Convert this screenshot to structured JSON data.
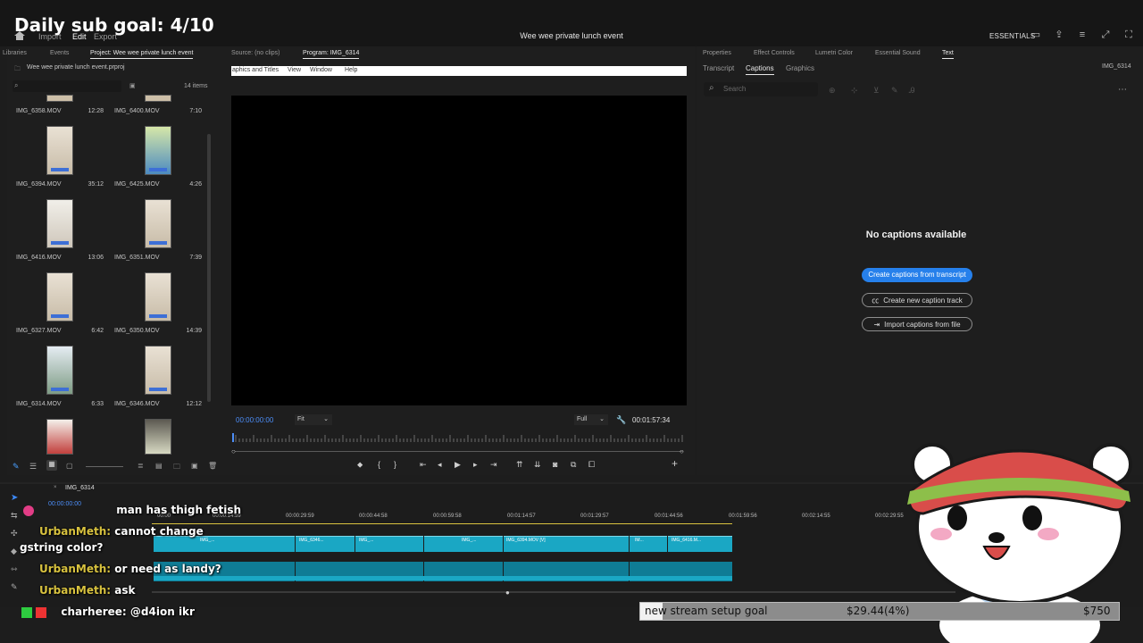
{
  "stream": {
    "goal_title": "Daily sub goal: 4/10",
    "donation_goal": {
      "label": "new stream setup goal",
      "current": "$29.44(4%)",
      "target": "$750",
      "progress_fraction": 0.04
    }
  },
  "app": {
    "menu": [
      "Import",
      "Edit",
      "Export"
    ],
    "active_menu": "Edit",
    "window_title": "Wee wee private lunch event",
    "workspace": "ESSENTIALS"
  },
  "project_panel": {
    "tabs": [
      "Libraries",
      "Events",
      "Project: Wee wee private lunch event"
    ],
    "path": "Wee wee private lunch event.prproj",
    "items_count": "14 items",
    "items": [
      {
        "name": "IMG_6358.MOV",
        "duration": "12:28"
      },
      {
        "name": "IMG_6400.MOV",
        "duration": "7:10"
      },
      {
        "name": "IMG_6394.MOV",
        "duration": "35:12"
      },
      {
        "name": "IMG_6425.MOV",
        "duration": "4:26"
      },
      {
        "name": "IMG_6416.MOV",
        "duration": "13:06"
      },
      {
        "name": "IMG_6351.MOV",
        "duration": "7:39"
      },
      {
        "name": "IMG_6327.MOV",
        "duration": "6:42"
      },
      {
        "name": "IMG_6350.MOV",
        "duration": "14:39"
      },
      {
        "name": "IMG_6314.MOV",
        "duration": "6:33"
      },
      {
        "name": "IMG_6346.MOV",
        "duration": "12:12"
      }
    ]
  },
  "program_monitor": {
    "tabs": [
      "Source: (no clips)",
      "Program: IMG_6314"
    ],
    "menu_strip": [
      "aphics and Titles",
      "View",
      "Window",
      "Help"
    ],
    "timecode": "00:00:00:00",
    "fit": "Fit",
    "quality": "Full",
    "duration": "00:01:57:34"
  },
  "right_panel": {
    "tabs": [
      "Properties",
      "Effect Controls",
      "Lumetri Color",
      "Essential Sound",
      "Text"
    ],
    "subtabs": [
      "Transcript",
      "Captions",
      "Graphics"
    ],
    "sequence_name": "IMG_6314",
    "search_placeholder": "Search",
    "no_captions": "No captions available",
    "buttons": {
      "from_transcript": "Create captions from transcript",
      "new_track": "Create new caption track",
      "import_file": "Import captions from file"
    }
  },
  "timeline": {
    "sequence_tab": "IMG_6314",
    "timecode": "00:00:00:00",
    "ruler": [
      "00:00",
      "00:00:14:59",
      "00:00:29:59",
      "00:00:44:58",
      "00:00:59:58",
      "00:01:14:57",
      "00:01:29:57",
      "00:01:44:56",
      "00:01:59:56",
      "00:02:14:55",
      "00:02:29:55"
    ],
    "clip_labels": [
      "IMG_...",
      "IMG_6346...",
      "IMG_...",
      "IMG_...",
      "IMG_6394.MOV [V]",
      "IM...",
      "IMG_6416.M..."
    ]
  },
  "chat": [
    {
      "user": "",
      "text": "man has thigh fetish"
    },
    {
      "user": "UrbanMeth:",
      "text": "cannot change"
    },
    {
      "user": "",
      "text": "gstring color?"
    },
    {
      "user": "UrbanMeth:",
      "text": "or need as landy?"
    },
    {
      "user": "UrbanMeth:",
      "text": "ask"
    },
    {
      "user": "charheree:",
      "text": "@d4ion ikr"
    }
  ]
}
